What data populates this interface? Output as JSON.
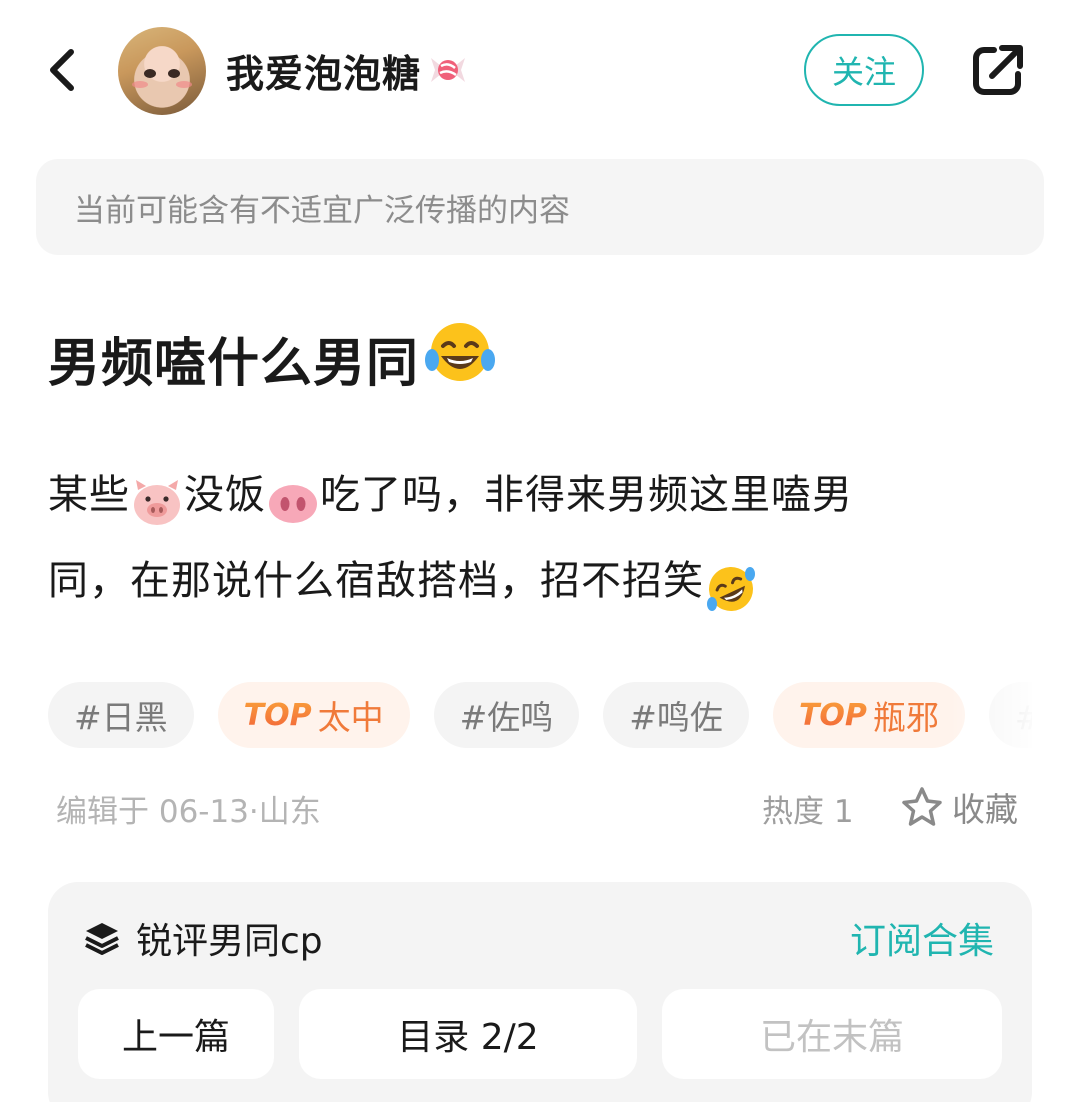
{
  "header": {
    "username": "我爱泡泡糖",
    "follow_label": "关注",
    "icons": [
      "back-arrow-icon",
      "candy-icon",
      "share-icon"
    ],
    "accent_color": "#20b5b0"
  },
  "warning": {
    "text": "当前可能含有不适宜广泛传播的内容"
  },
  "post": {
    "title": "男频嗑什么男同",
    "title_emoji": "tears-of-joy-emoji",
    "body": {
      "line1_a": "某些",
      "line1_b": "没饭",
      "line1_c": "吃了吗，非得来男频这里嗑男",
      "line2_a": "同，在那说什么宿敌搭档，招不招笑",
      "emojis": [
        "pig-face-emoji",
        "pig-nose-emoji",
        "rofl-emoji"
      ]
    }
  },
  "tags": [
    {
      "label": "#日黑",
      "type": "plain"
    },
    {
      "prefix": "TOP",
      "label": "太中",
      "type": "hot"
    },
    {
      "label": "#佐鸣",
      "type": "plain"
    },
    {
      "label": "#鸣佐",
      "type": "plain"
    },
    {
      "prefix": "TOP",
      "label": "瓶邪",
      "type": "hot"
    },
    {
      "label": "#缘",
      "type": "plain"
    }
  ],
  "meta": {
    "edited": "编辑于 06-13·山东",
    "heat": "热度 1",
    "collect_label": "收藏"
  },
  "collection": {
    "name": "锐评男同cp",
    "subscribe_label": "订阅合集",
    "prev_label": "上一篇",
    "toc_label": "目录 2/2",
    "next_label": "已在末篇"
  }
}
